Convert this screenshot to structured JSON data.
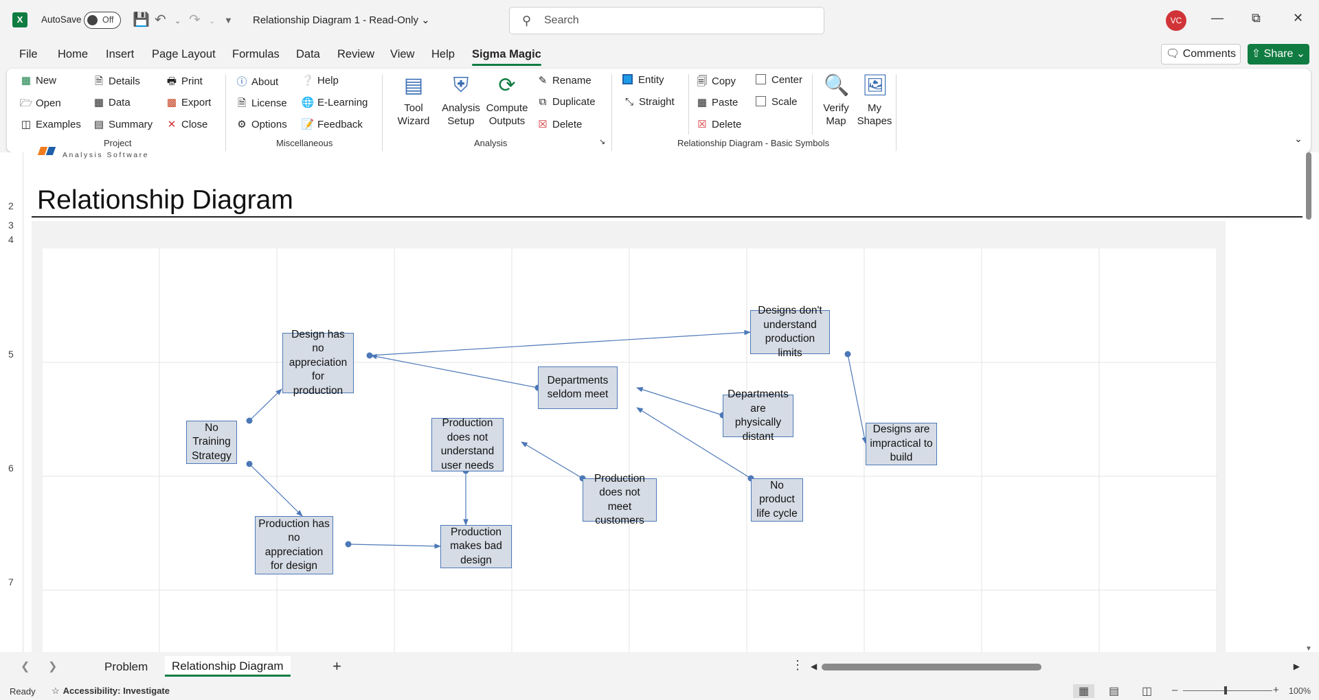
{
  "titlebar": {
    "autosave_label": "AutoSave",
    "autosave_state": "Off",
    "doc_title": "Relationship Diagram 1  -  Read-Only",
    "search_placeholder": "Search",
    "user_initials": "VC"
  },
  "menu": {
    "tabs": [
      "File",
      "Home",
      "Insert",
      "Page Layout",
      "Formulas",
      "Data",
      "Review",
      "View",
      "Help",
      "Sigma Magic"
    ],
    "active": "Sigma Magic",
    "comments_label": "Comments",
    "share_label": "Share"
  },
  "ribbon": {
    "project": {
      "label": "Project",
      "col1": [
        "New",
        "Open",
        "Examples"
      ],
      "col2": [
        "Details",
        "Data",
        "Summary"
      ],
      "col3": [
        "Print",
        "Export",
        "Close"
      ]
    },
    "misc": {
      "label": "Miscellaneous",
      "col1": [
        "About",
        "License",
        "Options"
      ],
      "col2": [
        "Help",
        "E-Learning",
        "Feedback"
      ]
    },
    "analysis": {
      "label": "Analysis",
      "big": [
        "Tool\nWizard",
        "Analysis\nSetup",
        "Compute\nOutputs"
      ],
      "col": [
        "Rename",
        "Duplicate",
        "Delete"
      ]
    },
    "symbols": {
      "label": "Relationship Diagram - Basic Symbols",
      "col1": [
        "Entity",
        "Straight"
      ],
      "col2": [
        "Copy",
        "Paste",
        "Delete"
      ],
      "col3": [
        "Center",
        "Scale"
      ],
      "big": [
        "Verify\nMap",
        "My\nShapes"
      ]
    }
  },
  "sheet": {
    "logo_text": "Analysis Software",
    "title": "Relationship Diagram",
    "row_numbers": [
      "2",
      "3",
      "4",
      "5",
      "6",
      "7"
    ]
  },
  "diagram": {
    "nodes": [
      {
        "id": "n1",
        "text": "Design has no\nappreciation\nfor production"
      },
      {
        "id": "n2",
        "text": "Designs don't\nunderstand\nproduction limits"
      },
      {
        "id": "n3",
        "text": "Departments\nseldom meet"
      },
      {
        "id": "n4",
        "text": "Departments\nare physically\ndistant"
      },
      {
        "id": "n5",
        "text": "No\nTraining\nStrategy"
      },
      {
        "id": "n6",
        "text": "Production\ndoes not\nunderstand\nuser needs"
      },
      {
        "id": "n7",
        "text": "Designs are\nimpractical to\nbuild"
      },
      {
        "id": "n8",
        "text": "Production\ndoes not meet\ncustomers"
      },
      {
        "id": "n9",
        "text": "No\nproduct\nlife cycle"
      },
      {
        "id": "n10",
        "text": "Production has\nno appreciation\nfor design"
      },
      {
        "id": "n11",
        "text": "Production\nmakes bad\ndesign"
      }
    ],
    "edges": [
      {
        "from": "n1",
        "to": "n2"
      },
      {
        "from": "n3",
        "to": "n1"
      },
      {
        "from": "n4",
        "to": "n3"
      },
      {
        "from": "n9",
        "to": "n3"
      },
      {
        "from": "n2",
        "to": "n7"
      },
      {
        "from": "n5",
        "to": "n1"
      },
      {
        "from": "n5",
        "to": "n10"
      },
      {
        "from": "n8",
        "to": "n6"
      },
      {
        "from": "n6",
        "to": "n11"
      },
      {
        "from": "n10",
        "to": "n11"
      }
    ],
    "node_fill": "#d6dce5",
    "node_border": "#4c78b7",
    "edge_color": "#4c78b7"
  },
  "sheet_tabs": {
    "tabs": [
      "Problem",
      "Relationship Diagram"
    ],
    "active": "Relationship Diagram"
  },
  "statusbar": {
    "ready": "Ready",
    "accessibility": "Accessibility: Investigate",
    "zoom": "100%"
  },
  "colors": {
    "accent": "#107c41",
    "avatar": "#d13438"
  }
}
